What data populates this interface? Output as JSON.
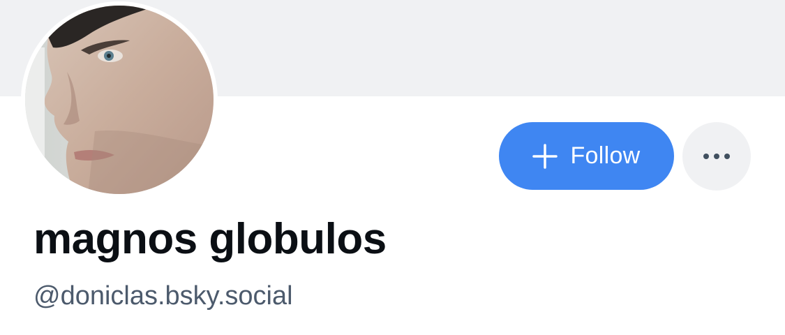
{
  "profile": {
    "display_name": "magnos globulos",
    "handle": "@doniclas.bsky.social",
    "avatar_icon": "profile-photo"
  },
  "actions": {
    "follow_label": "Follow",
    "follow_icon": "plus-icon",
    "more_icon": "more-horizontal-icon"
  },
  "colors": {
    "banner": "#f0f1f3",
    "accent": "#3f86f2",
    "name_text": "#0b0f14",
    "handle_text": "#4c5a6c"
  }
}
